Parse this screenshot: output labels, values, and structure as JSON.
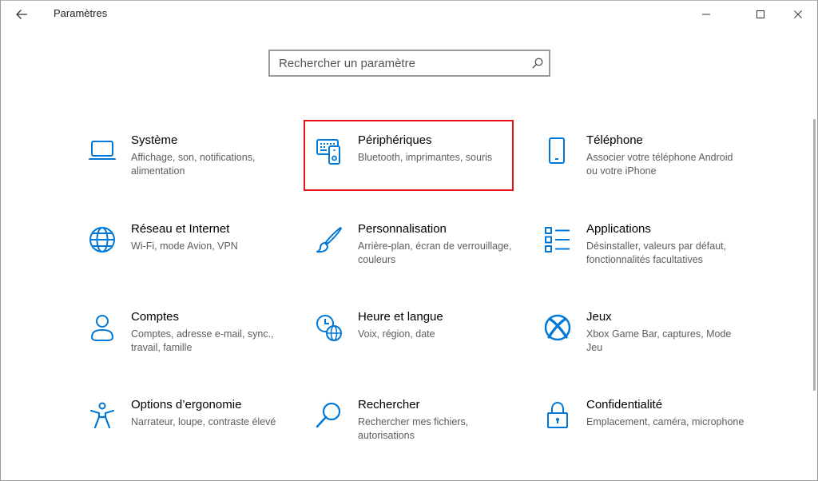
{
  "window": {
    "title": "Paramètres"
  },
  "search": {
    "placeholder": "Rechercher un paramètre"
  },
  "tiles": [
    {
      "name": "Système",
      "desc": "Affichage, son, notifications, alimentation"
    },
    {
      "name": "Périphériques",
      "desc": "Bluetooth, imprimantes, souris"
    },
    {
      "name": "Téléphone",
      "desc": "Associer votre téléphone Android ou votre iPhone"
    },
    {
      "name": "Réseau et Internet",
      "desc": "Wi-Fi, mode Avion, VPN"
    },
    {
      "name": "Personnalisation",
      "desc": "Arrière-plan, écran de verrouillage, couleurs"
    },
    {
      "name": "Applications",
      "desc": "Désinstaller, valeurs par défaut, fonctionnalités facultatives"
    },
    {
      "name": "Comptes",
      "desc": "Comptes, adresse e-mail, sync., travail, famille"
    },
    {
      "name": "Heure et langue",
      "desc": "Voix, région, date"
    },
    {
      "name": "Jeux",
      "desc": "Xbox Game Bar, captures, Mode Jeu"
    },
    {
      "name": "Options d’ergonomie",
      "desc": "Narrateur, loupe, contraste élevé"
    },
    {
      "name": "Rechercher",
      "desc": "Rechercher mes fichiers, autorisations"
    },
    {
      "name": "Confidentialité",
      "desc": "Emplacement, caméra, microphone"
    }
  ],
  "colors": {
    "accent": "#0078d7",
    "highlight": "#e8121b"
  },
  "icons": [
    "back-arrow-icon",
    "minimize-icon",
    "maximize-icon",
    "close-icon",
    "search-icon",
    "laptop-icon",
    "keyboard-device-icon",
    "phone-icon",
    "globe-icon",
    "paintbrush-icon",
    "app-list-icon",
    "person-icon",
    "clock-language-icon",
    "xbox-icon",
    "accessibility-icon",
    "magnifier-icon",
    "lock-icon"
  ]
}
